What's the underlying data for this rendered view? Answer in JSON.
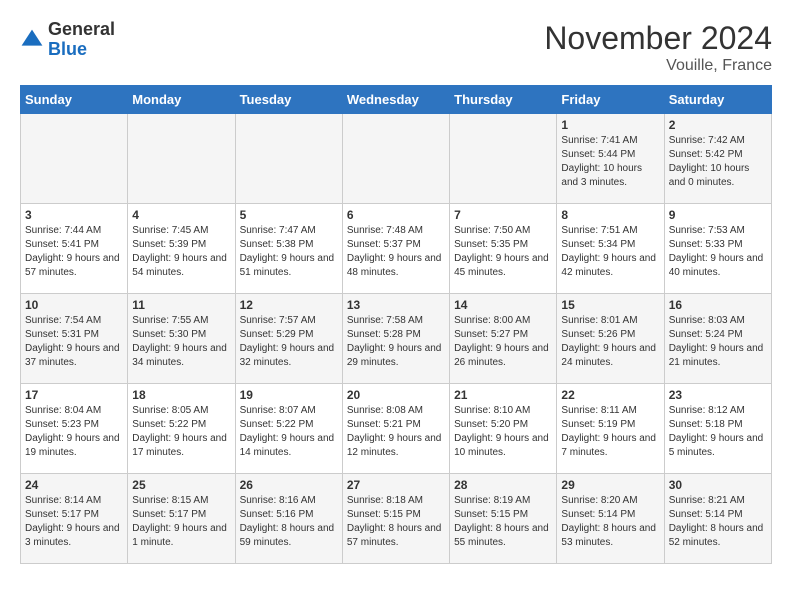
{
  "header": {
    "logo_general": "General",
    "logo_blue": "Blue",
    "title": "November 2024",
    "subtitle": "Vouille, France"
  },
  "weekdays": [
    "Sunday",
    "Monday",
    "Tuesday",
    "Wednesday",
    "Thursday",
    "Friday",
    "Saturday"
  ],
  "weeks": [
    [
      {
        "day": "",
        "info": ""
      },
      {
        "day": "",
        "info": ""
      },
      {
        "day": "",
        "info": ""
      },
      {
        "day": "",
        "info": ""
      },
      {
        "day": "",
        "info": ""
      },
      {
        "day": "1",
        "info": "Sunrise: 7:41 AM\nSunset: 5:44 PM\nDaylight: 10 hours and 3 minutes."
      },
      {
        "day": "2",
        "info": "Sunrise: 7:42 AM\nSunset: 5:42 PM\nDaylight: 10 hours and 0 minutes."
      }
    ],
    [
      {
        "day": "3",
        "info": "Sunrise: 7:44 AM\nSunset: 5:41 PM\nDaylight: 9 hours and 57 minutes."
      },
      {
        "day": "4",
        "info": "Sunrise: 7:45 AM\nSunset: 5:39 PM\nDaylight: 9 hours and 54 minutes."
      },
      {
        "day": "5",
        "info": "Sunrise: 7:47 AM\nSunset: 5:38 PM\nDaylight: 9 hours and 51 minutes."
      },
      {
        "day": "6",
        "info": "Sunrise: 7:48 AM\nSunset: 5:37 PM\nDaylight: 9 hours and 48 minutes."
      },
      {
        "day": "7",
        "info": "Sunrise: 7:50 AM\nSunset: 5:35 PM\nDaylight: 9 hours and 45 minutes."
      },
      {
        "day": "8",
        "info": "Sunrise: 7:51 AM\nSunset: 5:34 PM\nDaylight: 9 hours and 42 minutes."
      },
      {
        "day": "9",
        "info": "Sunrise: 7:53 AM\nSunset: 5:33 PM\nDaylight: 9 hours and 40 minutes."
      }
    ],
    [
      {
        "day": "10",
        "info": "Sunrise: 7:54 AM\nSunset: 5:31 PM\nDaylight: 9 hours and 37 minutes."
      },
      {
        "day": "11",
        "info": "Sunrise: 7:55 AM\nSunset: 5:30 PM\nDaylight: 9 hours and 34 minutes."
      },
      {
        "day": "12",
        "info": "Sunrise: 7:57 AM\nSunset: 5:29 PM\nDaylight: 9 hours and 32 minutes."
      },
      {
        "day": "13",
        "info": "Sunrise: 7:58 AM\nSunset: 5:28 PM\nDaylight: 9 hours and 29 minutes."
      },
      {
        "day": "14",
        "info": "Sunrise: 8:00 AM\nSunset: 5:27 PM\nDaylight: 9 hours and 26 minutes."
      },
      {
        "day": "15",
        "info": "Sunrise: 8:01 AM\nSunset: 5:26 PM\nDaylight: 9 hours and 24 minutes."
      },
      {
        "day": "16",
        "info": "Sunrise: 8:03 AM\nSunset: 5:24 PM\nDaylight: 9 hours and 21 minutes."
      }
    ],
    [
      {
        "day": "17",
        "info": "Sunrise: 8:04 AM\nSunset: 5:23 PM\nDaylight: 9 hours and 19 minutes."
      },
      {
        "day": "18",
        "info": "Sunrise: 8:05 AM\nSunset: 5:22 PM\nDaylight: 9 hours and 17 minutes."
      },
      {
        "day": "19",
        "info": "Sunrise: 8:07 AM\nSunset: 5:22 PM\nDaylight: 9 hours and 14 minutes."
      },
      {
        "day": "20",
        "info": "Sunrise: 8:08 AM\nSunset: 5:21 PM\nDaylight: 9 hours and 12 minutes."
      },
      {
        "day": "21",
        "info": "Sunrise: 8:10 AM\nSunset: 5:20 PM\nDaylight: 9 hours and 10 minutes."
      },
      {
        "day": "22",
        "info": "Sunrise: 8:11 AM\nSunset: 5:19 PM\nDaylight: 9 hours and 7 minutes."
      },
      {
        "day": "23",
        "info": "Sunrise: 8:12 AM\nSunset: 5:18 PM\nDaylight: 9 hours and 5 minutes."
      }
    ],
    [
      {
        "day": "24",
        "info": "Sunrise: 8:14 AM\nSunset: 5:17 PM\nDaylight: 9 hours and 3 minutes."
      },
      {
        "day": "25",
        "info": "Sunrise: 8:15 AM\nSunset: 5:17 PM\nDaylight: 9 hours and 1 minute."
      },
      {
        "day": "26",
        "info": "Sunrise: 8:16 AM\nSunset: 5:16 PM\nDaylight: 8 hours and 59 minutes."
      },
      {
        "day": "27",
        "info": "Sunrise: 8:18 AM\nSunset: 5:15 PM\nDaylight: 8 hours and 57 minutes."
      },
      {
        "day": "28",
        "info": "Sunrise: 8:19 AM\nSunset: 5:15 PM\nDaylight: 8 hours and 55 minutes."
      },
      {
        "day": "29",
        "info": "Sunrise: 8:20 AM\nSunset: 5:14 PM\nDaylight: 8 hours and 53 minutes."
      },
      {
        "day": "30",
        "info": "Sunrise: 8:21 AM\nSunset: 5:14 PM\nDaylight: 8 hours and 52 minutes."
      }
    ]
  ]
}
